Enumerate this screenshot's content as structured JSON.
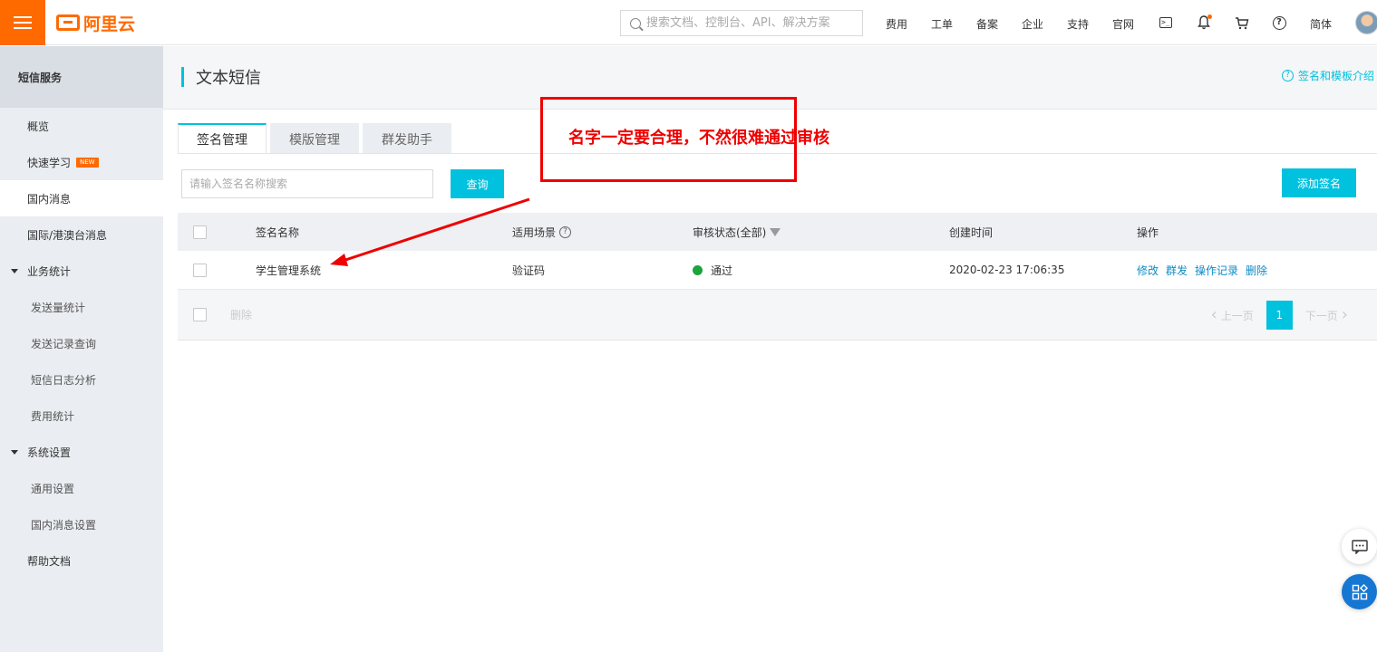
{
  "topbar": {
    "logo_text": "阿里云",
    "search_placeholder": "搜索文档、控制台、API、解决方案",
    "nav": [
      "费用",
      "工单",
      "备案",
      "企业",
      "支持",
      "官网"
    ],
    "lang": "简体",
    "brand_color": "#ff6a00"
  },
  "sidebar": {
    "title": "短信服务",
    "items": [
      {
        "label": "概览"
      },
      {
        "label": "快速学习",
        "badge": "NEW"
      },
      {
        "label": "国内消息"
      },
      {
        "label": "国际/港澳台消息"
      },
      {
        "label": "业务统计"
      },
      {
        "label": "发送量统计"
      },
      {
        "label": "发送记录查询"
      },
      {
        "label": "短信日志分析"
      },
      {
        "label": "费用统计"
      },
      {
        "label": "系统设置"
      },
      {
        "label": "通用设置"
      },
      {
        "label": "国内消息设置"
      },
      {
        "label": "帮助文档"
      }
    ]
  },
  "page": {
    "title": "文本短信",
    "help_link": "签名和模板介绍",
    "accent_color": "#00c1de"
  },
  "tabs": [
    "签名管理",
    "模版管理",
    "群发助手"
  ],
  "search": {
    "placeholder": "请输入签名名称搜索",
    "query_button": "查询",
    "add_button": "添加签名"
  },
  "table": {
    "headers": {
      "name": "签名名称",
      "scene": "适用场景",
      "status": "审核状态(全部)",
      "created": "创建时间",
      "actions": "操作"
    },
    "rows": [
      {
        "name": "学生管理系统",
        "scene": "验证码",
        "status": "通过",
        "created": "2020-02-23 17:06:35",
        "actions": [
          "修改",
          "群发",
          "操作记录",
          "删除"
        ]
      }
    ],
    "footer": {
      "delete_label": "删除",
      "prev_label": "上一页",
      "next_label": "下一页",
      "current_page": "1"
    }
  },
  "annotation": {
    "text": "名字一定要合理，不然很难通过审核",
    "color": "#ee0000"
  }
}
